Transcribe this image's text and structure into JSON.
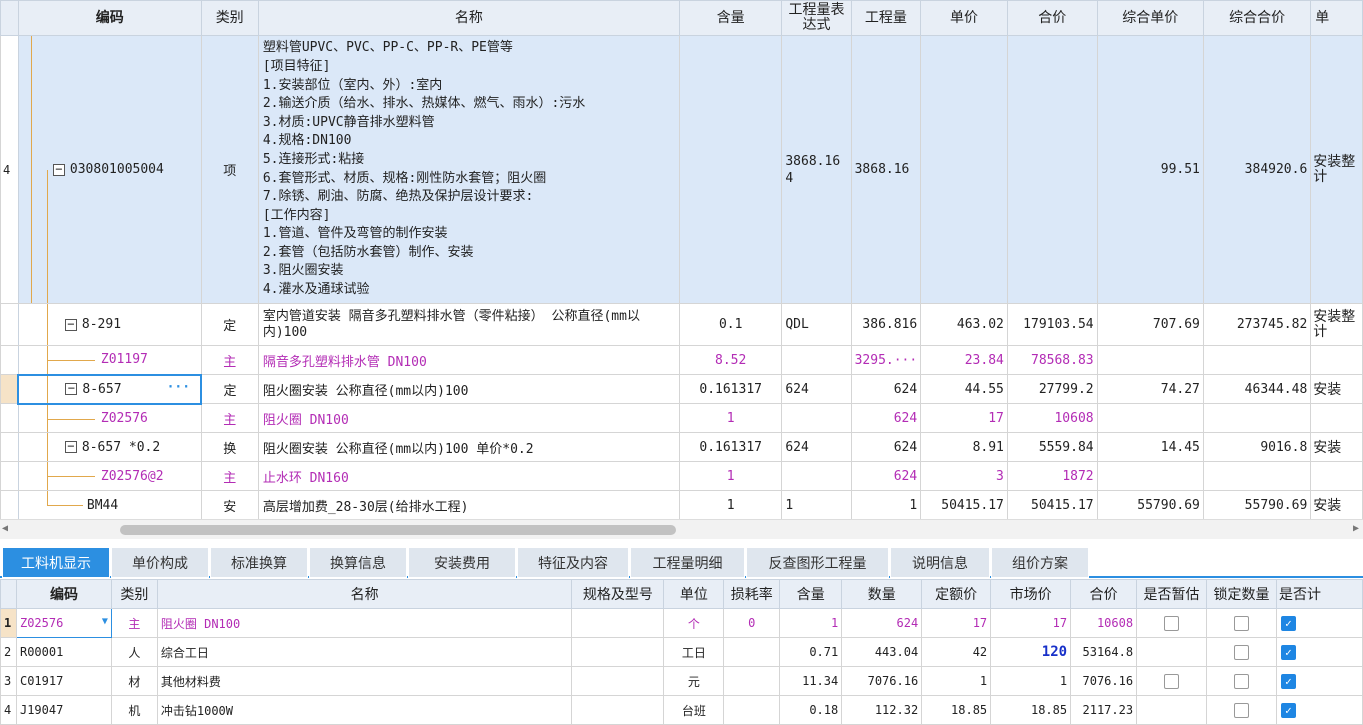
{
  "top_table": {
    "headers": [
      "编码",
      "类别",
      "名称",
      "含量",
      "工程量表达式",
      "工程量",
      "单价",
      "合价",
      "综合单价",
      "综合合价",
      "单"
    ],
    "row1": {
      "index": "4",
      "code": "030801005004",
      "type": "项",
      "name_lines": [
        "塑料管UPVC、PVC、PP-C、PP-R、PE管等",
        "[项目特征]",
        "1.安装部位（室内、外）:室内",
        "2.输送介质（给水、排水、热媒体、燃气、雨水）:污水",
        "3.材质:UPVC静音排水塑料管",
        "4.规格:DN100",
        "5.连接形式:粘接",
        "6.套管形式、材质、规格:刚性防水套管；阻火圈",
        "7.除锈、刷油、防腐、绝热及保护层设计要求:",
        "[工作内容]",
        "1.管道、管件及弯管的制作安装",
        "2.套管（包括防水套管）制作、安装",
        "3.阻火圈安装",
        "4.灌水及通球试验"
      ],
      "content": "",
      "expr": "3868.164",
      "qty": "3868.16",
      "unit_price": "",
      "total": "",
      "comp_price": "99.51",
      "comp_total": "384920.6",
      "extra": "安装整计"
    },
    "rows": [
      {
        "code": "8-291",
        "type": "定",
        "name": "室内管道安装 隔音多孔塑料排水管（零件粘接） 公称直径(mm以内)100",
        "content": "0.1",
        "expr": "QDL",
        "qty": "386.816",
        "unit_price": "463.02",
        "total": "179103.54",
        "comp_price": "707.69",
        "comp_total": "273745.82",
        "extra": "安装整计"
      },
      {
        "code": "Z01197",
        "type": "主",
        "name": "隔音多孔塑料排水管 DN100",
        "content": "8.52",
        "expr": "",
        "qty": "3295.···",
        "unit_price": "23.84",
        "total": "78568.83",
        "comp_price": "",
        "comp_total": "",
        "extra": ""
      },
      {
        "code": "8-657",
        "type": "定",
        "name": "阻火圈安装 公称直径(mm以内)100",
        "content": "0.161317",
        "expr": "624",
        "qty": "624",
        "unit_price": "44.55",
        "total": "27799.2",
        "comp_price": "74.27",
        "comp_total": "46344.48",
        "extra": "安装",
        "dots": "···"
      },
      {
        "code": "Z02576",
        "type": "主",
        "name": "阻火圈 DN100",
        "content": "1",
        "expr": "",
        "qty": "624",
        "unit_price": "17",
        "total": "10608",
        "comp_price": "",
        "comp_total": "",
        "extra": ""
      },
      {
        "code": "8-657 *0.2",
        "type": "换",
        "name": "阻火圈安装 公称直径(mm以内)100  单价*0.2",
        "content": "0.161317",
        "expr": "624",
        "qty": "624",
        "unit_price": "8.91",
        "total": "5559.84",
        "comp_price": "14.45",
        "comp_total": "9016.8",
        "extra": "安装"
      },
      {
        "code": "Z02576@2",
        "type": "主",
        "name": "止水环 DN160",
        "content": "1",
        "expr": "",
        "qty": "624",
        "unit_price": "3",
        "total": "1872",
        "comp_price": "",
        "comp_total": "",
        "extra": ""
      },
      {
        "code": "BM44",
        "type": "安",
        "name": "高层增加费_28-30层(给排水工程)",
        "content": "1",
        "expr": "1",
        "qty": "1",
        "unit_price": "50415.17",
        "total": "50415.17",
        "comp_price": "55790.69",
        "comp_total": "55790.69",
        "extra": "安装"
      }
    ]
  },
  "tabs": [
    "工料机显示",
    "单价构成",
    "标准换算",
    "换算信息",
    "安装费用",
    "特征及内容",
    "工程量明细",
    "反查图形工程量",
    "说明信息",
    "组价方案"
  ],
  "bottom_table": {
    "headers": [
      "编码",
      "类别",
      "名称",
      "规格及型号",
      "单位",
      "损耗率",
      "含量",
      "数量",
      "定额价",
      "市场价",
      "合价",
      "是否暂估",
      "锁定数量",
      "是否计"
    ],
    "rows": [
      {
        "idx": "1",
        "code": "Z02576",
        "type": "主",
        "name": "阻火圈 DN100",
        "spec": "",
        "unit": "个",
        "loss": "0",
        "content": "1",
        "qty": "624",
        "base": "17",
        "market": "17",
        "total": "10608",
        "est": false,
        "lock": false,
        "calc": true
      },
      {
        "idx": "2",
        "code": "R00001",
        "type": "人",
        "name": "综合工日",
        "spec": "",
        "unit": "工日",
        "loss": "",
        "content": "0.71",
        "qty": "443.04",
        "base": "42",
        "market": "120",
        "total": "53164.8",
        "est": null,
        "lock": false,
        "calc": true
      },
      {
        "idx": "3",
        "code": "C01917",
        "type": "材",
        "name": "其他材料费",
        "spec": "",
        "unit": "元",
        "loss": "",
        "content": "11.34",
        "qty": "7076.16",
        "base": "1",
        "market": "1",
        "total": "7076.16",
        "est": false,
        "lock": false,
        "calc": true
      },
      {
        "idx": "4",
        "code": "J19047",
        "type": "机",
        "name": "冲击钻1000W",
        "spec": "",
        "unit": "台班",
        "loss": "",
        "content": "0.18",
        "qty": "112.32",
        "base": "18.85",
        "market": "18.85",
        "total": "2117.23",
        "est": null,
        "lock": false,
        "calc": true
      }
    ]
  },
  "colors": {
    "accent": "#2c8fe1",
    "main_material": "#b32cb5",
    "selected_row": "#dbe8f8",
    "tree_line": "#e1a84c"
  }
}
